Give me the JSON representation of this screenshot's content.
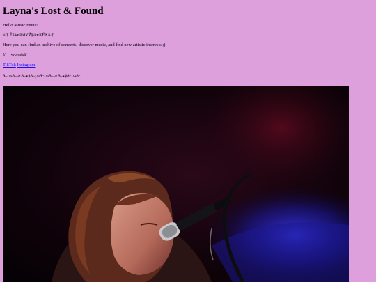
{
  "header": {
    "title": "Layna's Lost & Found"
  },
  "intro": {
    "greeting": "Hello Music Feins!",
    "decor_line": "â·†.Êšâœ®ðŸŽ§âœ®Éž.â·†",
    "description": "Here you can find an archive of concerts, discover music, and find new artistic interests ;)",
    "socials_heading": "â˜…Socialsâ˜…"
  },
  "socials": {
    "tiktok_label": "TikTok",
    "instagram_label": "Instagram"
  },
  "music_line": "ð–¡¼ð–¤£ð–¥§ð–¡¼ð“‹¼ð–¤£ð–¥§ð“‹¼ð“"
}
